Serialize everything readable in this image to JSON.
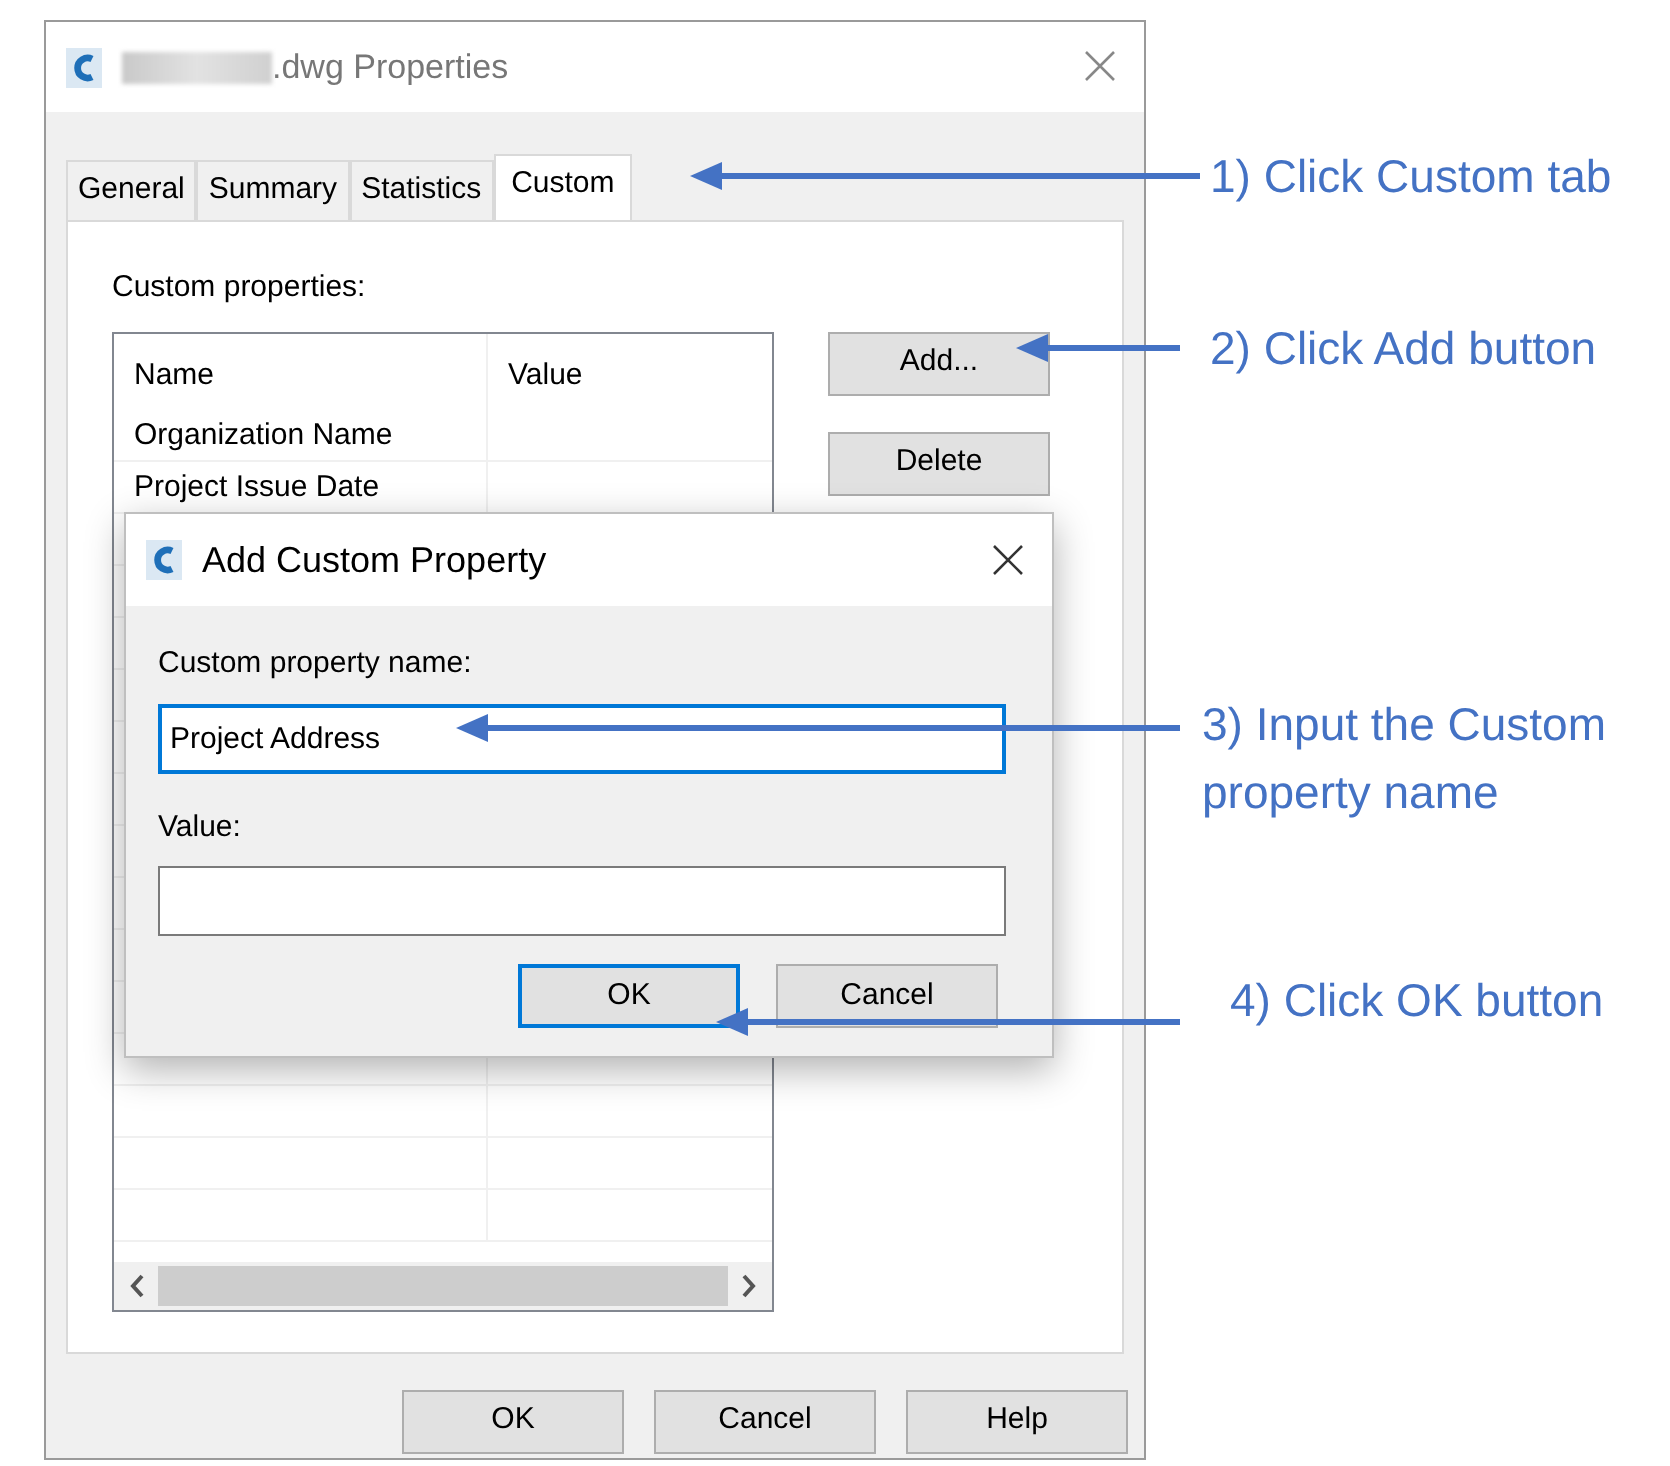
{
  "window": {
    "title": ".dwg Properties"
  },
  "tabs": [
    {
      "label": "General",
      "selected": false
    },
    {
      "label": "Summary",
      "selected": false
    },
    {
      "label": "Statistics",
      "selected": false
    },
    {
      "label": "Custom",
      "selected": true
    }
  ],
  "custom_properties_label": "Custom properties:",
  "table": {
    "columns": [
      "Name",
      "Value"
    ],
    "rows": [
      {
        "name": "Organization Name"
      },
      {
        "name": "Project Issue Date"
      }
    ]
  },
  "side_buttons": [
    "Add...",
    "Delete"
  ],
  "buttons": [
    "OK",
    "Cancel",
    "Help"
  ],
  "add_dialog": {
    "title": "Add Custom Property",
    "name_label": "Custom property name:",
    "name_value": "Project Address",
    "value_label": "Value:",
    "buttons": [
      {
        "label": "OK",
        "focused": true
      },
      {
        "label": "Cancel",
        "focused": false
      }
    ]
  },
  "annotations": [
    "1) Click Custom tab",
    "2) Click Add button",
    "3) Input the Custom property name",
    "4) Click OK button"
  ]
}
